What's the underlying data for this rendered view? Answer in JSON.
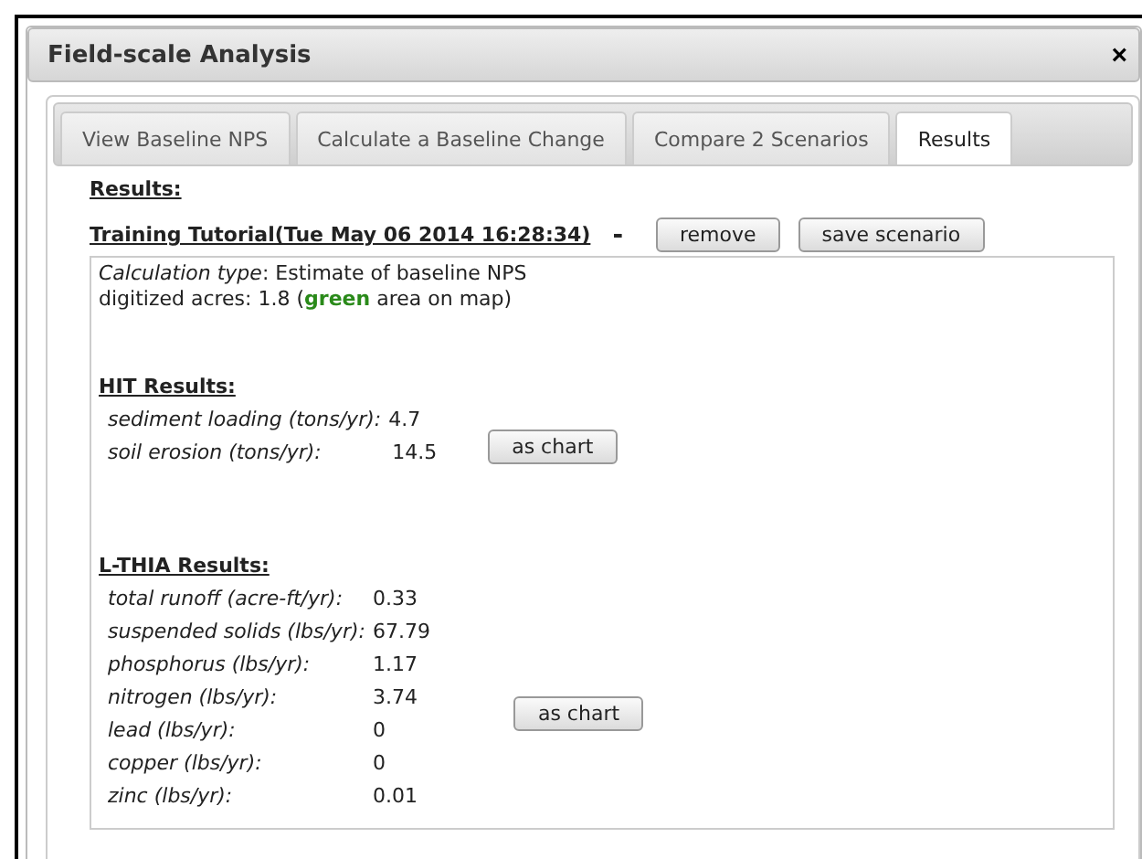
{
  "window": {
    "title": "Field-scale Analysis",
    "close": "×"
  },
  "tabs": [
    {
      "label": "View Baseline NPS",
      "selected": false
    },
    {
      "label": "Calculate a Baseline Change",
      "selected": false
    },
    {
      "label": "Compare 2 Scenarios",
      "selected": false
    },
    {
      "label": "Results",
      "selected": true
    }
  ],
  "results_heading": "Results:",
  "scenario": {
    "name": "Training Tutorial(Tue May 06 2014 16:28:34)",
    "dash": "-",
    "buttons": [
      "remove",
      "save scenario"
    ]
  },
  "info": [
    "*Calculation type*: Estimate of baseline NPS",
    "digitized acres: 1.8 (**green** area on map)"
  ],
  "sections": [
    {
      "heading": "HIT Results:",
      "button": "as chart",
      "rows": [
        {
          "label": "sediment loading (tons/yr):",
          "value": "4.7"
        },
        {
          "label": "soil erosion (tons/yr):",
          "value": "14.5"
        }
      ]
    },
    {
      "heading": "L-THIA Results:",
      "button": "as chart",
      "rows": [
        {
          "label": "total runoff (acre-ft/yr):",
          "value": "0.33"
        },
        {
          "label": "suspended solids (lbs/yr):",
          "value": "67.79"
        },
        {
          "label": "phosphorus (lbs/yr):",
          "value": "1.17"
        },
        {
          "label": "nitrogen (lbs/yr):",
          "value": "3.74"
        },
        {
          "label": "lead (lbs/yr):",
          "value": "0"
        },
        {
          "label": "copper (lbs/yr):",
          "value": "0"
        },
        {
          "label": "zinc (lbs/yr):",
          "value": "0.01"
        }
      ]
    }
  ]
}
